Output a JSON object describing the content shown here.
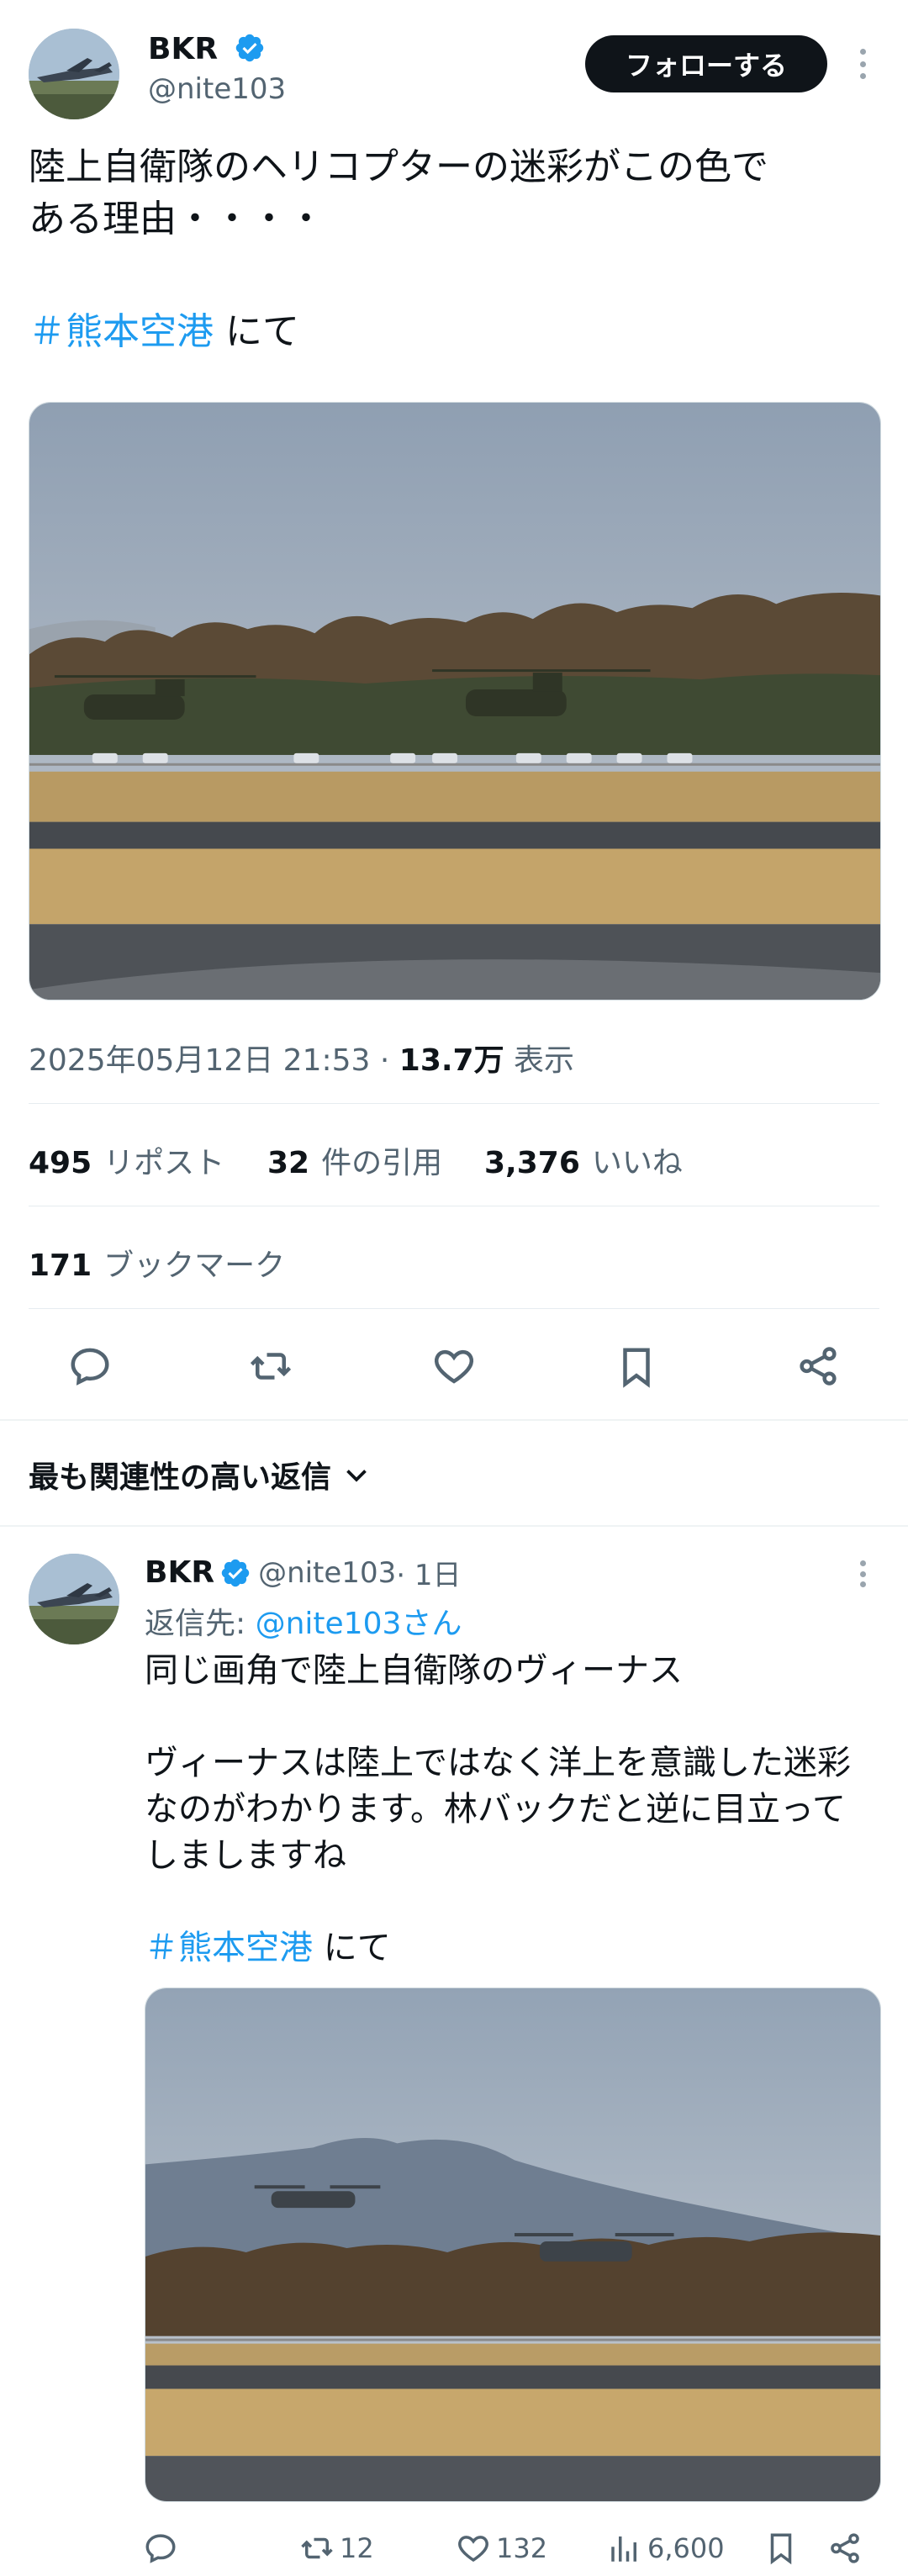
{
  "main_tweet": {
    "author_name": "BKR",
    "author_handle": "@nite103",
    "follow_label": "フォローする",
    "text_line1": "陸上自衛隊のヘリコプターの迷彩がこの色で",
    "text_line2": "ある理由・・・・",
    "hashtag": "＃熊本空港",
    "hashtag_suffix": " にて",
    "timestamp": "2025年05月12日 21:53 · ",
    "views_count": "13.7万",
    "views_label": " 表示",
    "reposts_count": "495",
    "reposts_label": "リポスト",
    "quotes_count": "32",
    "quotes_label": "件の引用",
    "likes_count": "3,376",
    "likes_label": "いいね",
    "bookmarks_count": "171",
    "bookmarks_label": "ブックマーク"
  },
  "replies_sort_label": "最も関連性の高い返信",
  "reply": {
    "author_name": "BKR",
    "author_handle": "@nite103",
    "time": " · 1日",
    "reply_to_label": "返信先: ",
    "reply_to_handle": "@nite103さん",
    "text_line1": "同じ画角で陸上自衛隊のヴィーナス",
    "text_line2": "ヴィーナスは陸上ではなく洋上を意識した迷彩",
    "text_line3": "なのがわかります。林バックだと逆に目立って",
    "text_line4": "しましますね",
    "hashtag": "＃熊本空港",
    "hashtag_suffix": " にて",
    "retweets": "12",
    "likes": "132",
    "views": "6,600"
  },
  "colors": {
    "accent": "#1d9bf0",
    "text": "#0f1419",
    "secondary": "#536471",
    "verified": "#1d9bf0"
  },
  "icons": [
    "verified-badge-icon",
    "more-icon",
    "reply-icon",
    "retweet-icon",
    "like-icon",
    "bookmark-icon",
    "share-icon",
    "chevron-down-icon",
    "views-icon"
  ]
}
